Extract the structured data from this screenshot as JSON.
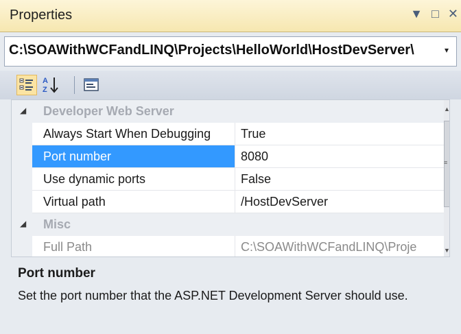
{
  "window": {
    "title": "Properties",
    "buttons": {
      "dropdown": "▼",
      "maximize": "□",
      "close": "✕"
    }
  },
  "object_selector": {
    "value": "C:\\SOAWithWCFandLINQ\\Projects\\HelloWorld\\HostDevServer\\",
    "dropdown_icon": "▾"
  },
  "toolbar": {
    "categorized": "categorized-view-icon",
    "alphabetical": "alphabetical-sort-icon",
    "property_pages": "property-pages-icon"
  },
  "grid": {
    "categories": [
      {
        "label": "Developer Web Server",
        "expanded": true
      },
      {
        "label": "Misc",
        "expanded": true
      }
    ],
    "rows": [
      {
        "name": "Always Start When Debugging",
        "value": "True"
      },
      {
        "name": "Port number",
        "value": "8080",
        "selected": true
      },
      {
        "name": "Use dynamic ports",
        "value": "False"
      },
      {
        "name": "Virtual path",
        "value": "/HostDevServer"
      },
      {
        "name": "Full Path",
        "value": "C:\\SOAWithWCFandLINQ\\Proje",
        "disabled": true
      }
    ],
    "expand_glyph": "◢"
  },
  "description": {
    "title": "Port number",
    "text": "Set the port number that the ASP.NET Development Server should use."
  },
  "colors": {
    "selection": "#3399ff",
    "titlebar": "#f6e7b0",
    "background": "#e7ebf0"
  }
}
